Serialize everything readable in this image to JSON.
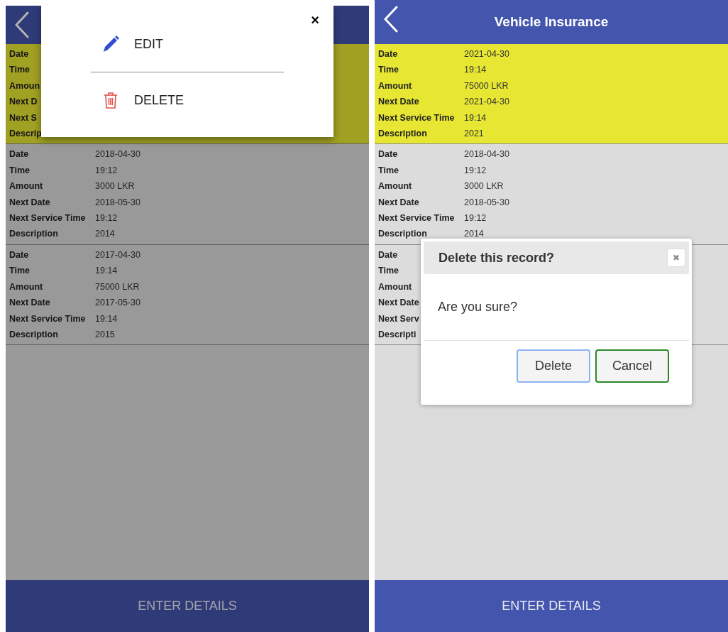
{
  "screens": [
    {
      "dimmed": true,
      "records": [
        {
          "selected": true,
          "fields": [
            {
              "label": "Date"
            },
            {
              "label": "Time"
            },
            {
              "label": "Amoun"
            },
            {
              "label": "Next D"
            },
            {
              "label": "Next S"
            },
            {
              "label": "Descrip"
            }
          ]
        },
        {
          "selected": false,
          "fields": [
            {
              "label": "Date",
              "value": "2018-04-30"
            },
            {
              "label": "Time",
              "value": "19:12"
            },
            {
              "label": "Amount",
              "value": "3000 LKR"
            },
            {
              "label": "Next Date",
              "value": "2018-05-30"
            },
            {
              "label": "Next Service Time",
              "value": "19:12"
            },
            {
              "label": "Description",
              "value": "2014"
            }
          ]
        },
        {
          "selected": false,
          "fields": [
            {
              "label": "Date",
              "value": "2017-04-30"
            },
            {
              "label": "Time",
              "value": "19:14"
            },
            {
              "label": "Amount",
              "value": "75000 LKR"
            },
            {
              "label": "Next Date",
              "value": "2017-05-30"
            },
            {
              "label": "Next Service Time",
              "value": "19:14"
            },
            {
              "label": "Description",
              "value": "2015"
            }
          ]
        }
      ],
      "popup": {
        "close": "×",
        "items": [
          {
            "kind": "edit",
            "label": "EDIT"
          },
          {
            "kind": "delete",
            "label": "DELETE"
          }
        ]
      },
      "footer_button": "ENTER DETAILS"
    },
    {
      "dimmed": false,
      "header": {
        "title": "Vehicle Insurance"
      },
      "records": [
        {
          "selected": true,
          "fields": [
            {
              "label": "Date",
              "value": "2021-04-30"
            },
            {
              "label": "Time",
              "value": "19:14"
            },
            {
              "label": "Amount",
              "value": "75000 LKR"
            },
            {
              "label": "Next Date",
              "value": "2021-04-30"
            },
            {
              "label": "Next Service Time",
              "value": "19:14"
            },
            {
              "label": "Description",
              "value": "2021"
            }
          ]
        },
        {
          "selected": false,
          "fields": [
            {
              "label": "Date",
              "value": "2018-04-30"
            },
            {
              "label": "Time",
              "value": "19:12"
            },
            {
              "label": "Amount",
              "value": "3000 LKR"
            },
            {
              "label": "Next Date",
              "value": "2018-05-30"
            },
            {
              "label": "Next Service Time",
              "value": "19:12"
            },
            {
              "label": "Description",
              "value": "2014"
            }
          ]
        },
        {
          "selected": false,
          "fields": [
            {
              "label": "Date"
            },
            {
              "label": "Time"
            },
            {
              "label": "Amount"
            },
            {
              "label": "Next Date"
            },
            {
              "label": "Next Serv"
            },
            {
              "label": "Descripti"
            }
          ]
        }
      ],
      "dialog": {
        "title": "Delete this record?",
        "close": "✖",
        "message": "Are you sure?",
        "buttons": [
          {
            "label": "Delete",
            "focused": true
          },
          {
            "label": "Cancel",
            "focused": false
          }
        ]
      },
      "footer_button": "ENTER DETAILS"
    }
  ]
}
